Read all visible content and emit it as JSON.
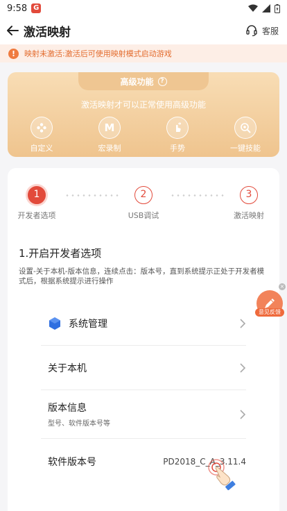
{
  "status_bar": {
    "time": "9:58",
    "app_badge": "G"
  },
  "header": {
    "title": "激活映射",
    "service_label": "客服"
  },
  "notice": {
    "text": "映射未激活:激活后可使用映射模式启动游戏"
  },
  "advanced": {
    "title": "高级功能",
    "description": "激活映射才可以正常使用高级功能",
    "features": [
      {
        "label": "自定义",
        "icon": "gamepad-icon"
      },
      {
        "label": "宏录制",
        "icon": "macro-m-icon",
        "glyph": "M"
      },
      {
        "label": "手势",
        "icon": "gesture-hand-icon"
      },
      {
        "label": "一键技能",
        "icon": "skill-icon"
      }
    ]
  },
  "steps": [
    {
      "num": "1",
      "label": "开发者选项"
    },
    {
      "num": "2",
      "label": "USB调试"
    },
    {
      "num": "3",
      "label": "激活映射"
    }
  ],
  "section": {
    "title": "1.开启开发者选项",
    "description": "设置-关于本机-版本信息，连续点击：版本号，直到系统提示正处于开发者模式后，根据系统提示进行操作"
  },
  "rows": {
    "system": "系统管理",
    "about": "关于本机",
    "version_info": "版本信息",
    "version_info_sub": "型号、软件版本号等",
    "software_version": "软件版本号",
    "software_version_value": "PD2018_C_A_3.11.4"
  },
  "feedback": {
    "label": "意见反馈"
  },
  "colors": {
    "accent": "#e24a3b",
    "gold": "#efc48e",
    "warning": "#ef7b40",
    "system_icon": "#2f6fe0"
  }
}
